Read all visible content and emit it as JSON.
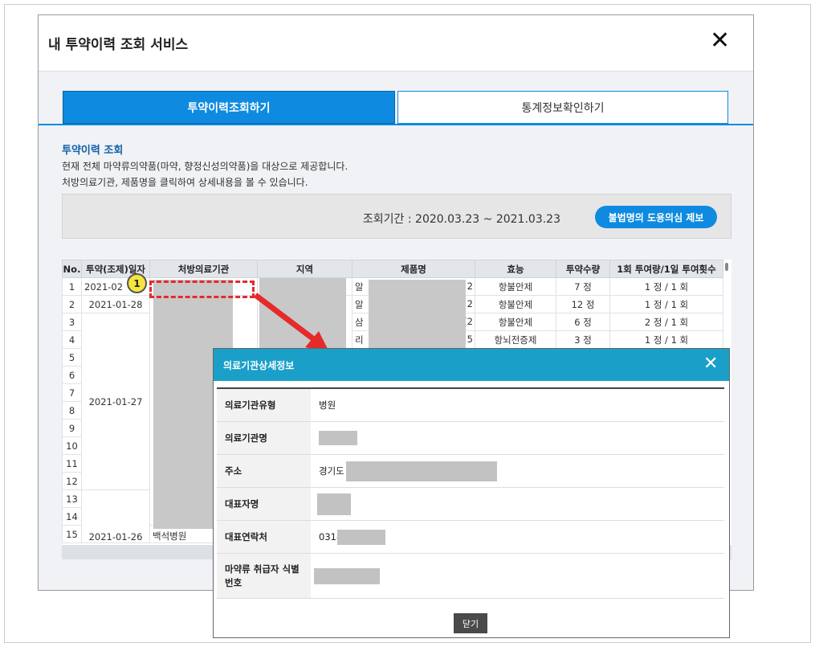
{
  "window": {
    "title": "내 투약이력 조회 서비스",
    "close_icon": "✕"
  },
  "tabs": [
    {
      "label": "투약이력조회하기",
      "active": true
    },
    {
      "label": "통계정보확인하기",
      "active": false
    }
  ],
  "section": {
    "title": "투약이력 조회",
    "desc1": "현재 전체 마약류의약품(마약, 향정신성의약품)을 대상으로 제공합니다.",
    "desc2": "처방의료기관, 제품명을 클릭하여 상세내용을 볼 수 있습니다."
  },
  "period": {
    "text": "조회기간 : 2020.03.23 ~ 2021.03.23",
    "report_button": "불법명의 도용의심 제보"
  },
  "table": {
    "headers": [
      "No.",
      "투약(조제)일자",
      "처방의료기관",
      "지역",
      "제품명",
      "효능",
      "투약수량",
      "1회 투여량/1일 투여횟수"
    ],
    "rows": [
      {
        "no": "1",
        "date": "2021-02",
        "product_left": "알",
        "product_right": "2",
        "effect": "항불안제",
        "qty": "7 정",
        "dose": "1 정 / 1 회"
      },
      {
        "no": "2",
        "date": "2021-01-28",
        "product_left": "알",
        "product_right": "2",
        "effect": "항불안제",
        "qty": "12 정",
        "dose": "1 정 / 1 회"
      },
      {
        "no": "3",
        "date": "",
        "product_left": "삼",
        "product_right": "(2",
        "effect": "항불안제",
        "qty": "6 정",
        "dose": "2 정 / 1 회"
      },
      {
        "no": "4",
        "date": "",
        "product_left": "리",
        "product_right": "5",
        "effect": "항뇌전증제",
        "qty": "3 정",
        "dose": "1 정 / 1 회"
      },
      {
        "no": "5"
      },
      {
        "no": "6"
      },
      {
        "no": "7"
      },
      {
        "no": "8"
      },
      {
        "no": "9"
      },
      {
        "no": "10"
      },
      {
        "no": "11"
      },
      {
        "no": "12"
      },
      {
        "no": "13"
      },
      {
        "no": "14"
      },
      {
        "no": "15"
      }
    ],
    "merged_date_1": "2021-01-27",
    "merged_date_2": "2021-01-26",
    "last_institution": "백석병원"
  },
  "annotation": {
    "badge": "1"
  },
  "colors": {
    "accent": "#0e8be0",
    "modal_header": "#1aa0c8",
    "highlight": "#e52a2a"
  },
  "modal": {
    "title": "의료기관상세정보",
    "close_icon": "✕",
    "rows": [
      {
        "key": "의료기관유형",
        "value": "병원"
      },
      {
        "key": "의료기관명",
        "value": ""
      },
      {
        "key": "주소",
        "value": "경기도"
      },
      {
        "key": "대표자명",
        "value": ""
      },
      {
        "key": "대표연락처",
        "value": "031-"
      },
      {
        "key": "마약류 취급자 식별번호",
        "value": ""
      }
    ],
    "close_button": "닫기"
  }
}
